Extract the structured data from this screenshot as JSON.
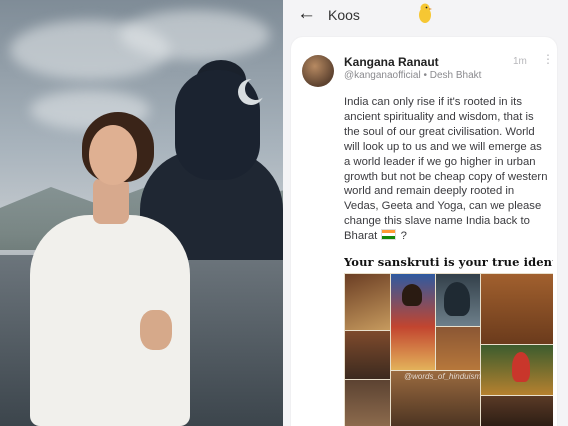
{
  "topbar": {
    "back_icon": "arrow-left-icon",
    "title": "Koos",
    "mascot_icon": "koo-bird-icon"
  },
  "post": {
    "author": "Kangana Ranaut",
    "handle": "@kanganaofficial",
    "separator": " • ",
    "tagline": "Desh Bhakt",
    "time": "1m",
    "more_icon": "kebab-icon",
    "text": "India can only rise if it's rooted in its ancient spirituality and wisdom, that is the soul of our great civilisation. World will look up to us and we will emerge as a world leader if we go higher in urban growth but not be cheap copy of western world and remain deeply rooted in Vedas, Geeta and Yoga, can we please change this slave name India back to Bharat",
    "flag_icon": "india-flag-icon",
    "text_end": " ?"
  },
  "poster": {
    "title": "Your sanskruti is your true identity",
    "watermark": "@words_of_hinduism"
  },
  "colors": {
    "flag_saffron": "#ff9933",
    "flag_green": "#138808",
    "koo_yellow": "#f6c733"
  }
}
